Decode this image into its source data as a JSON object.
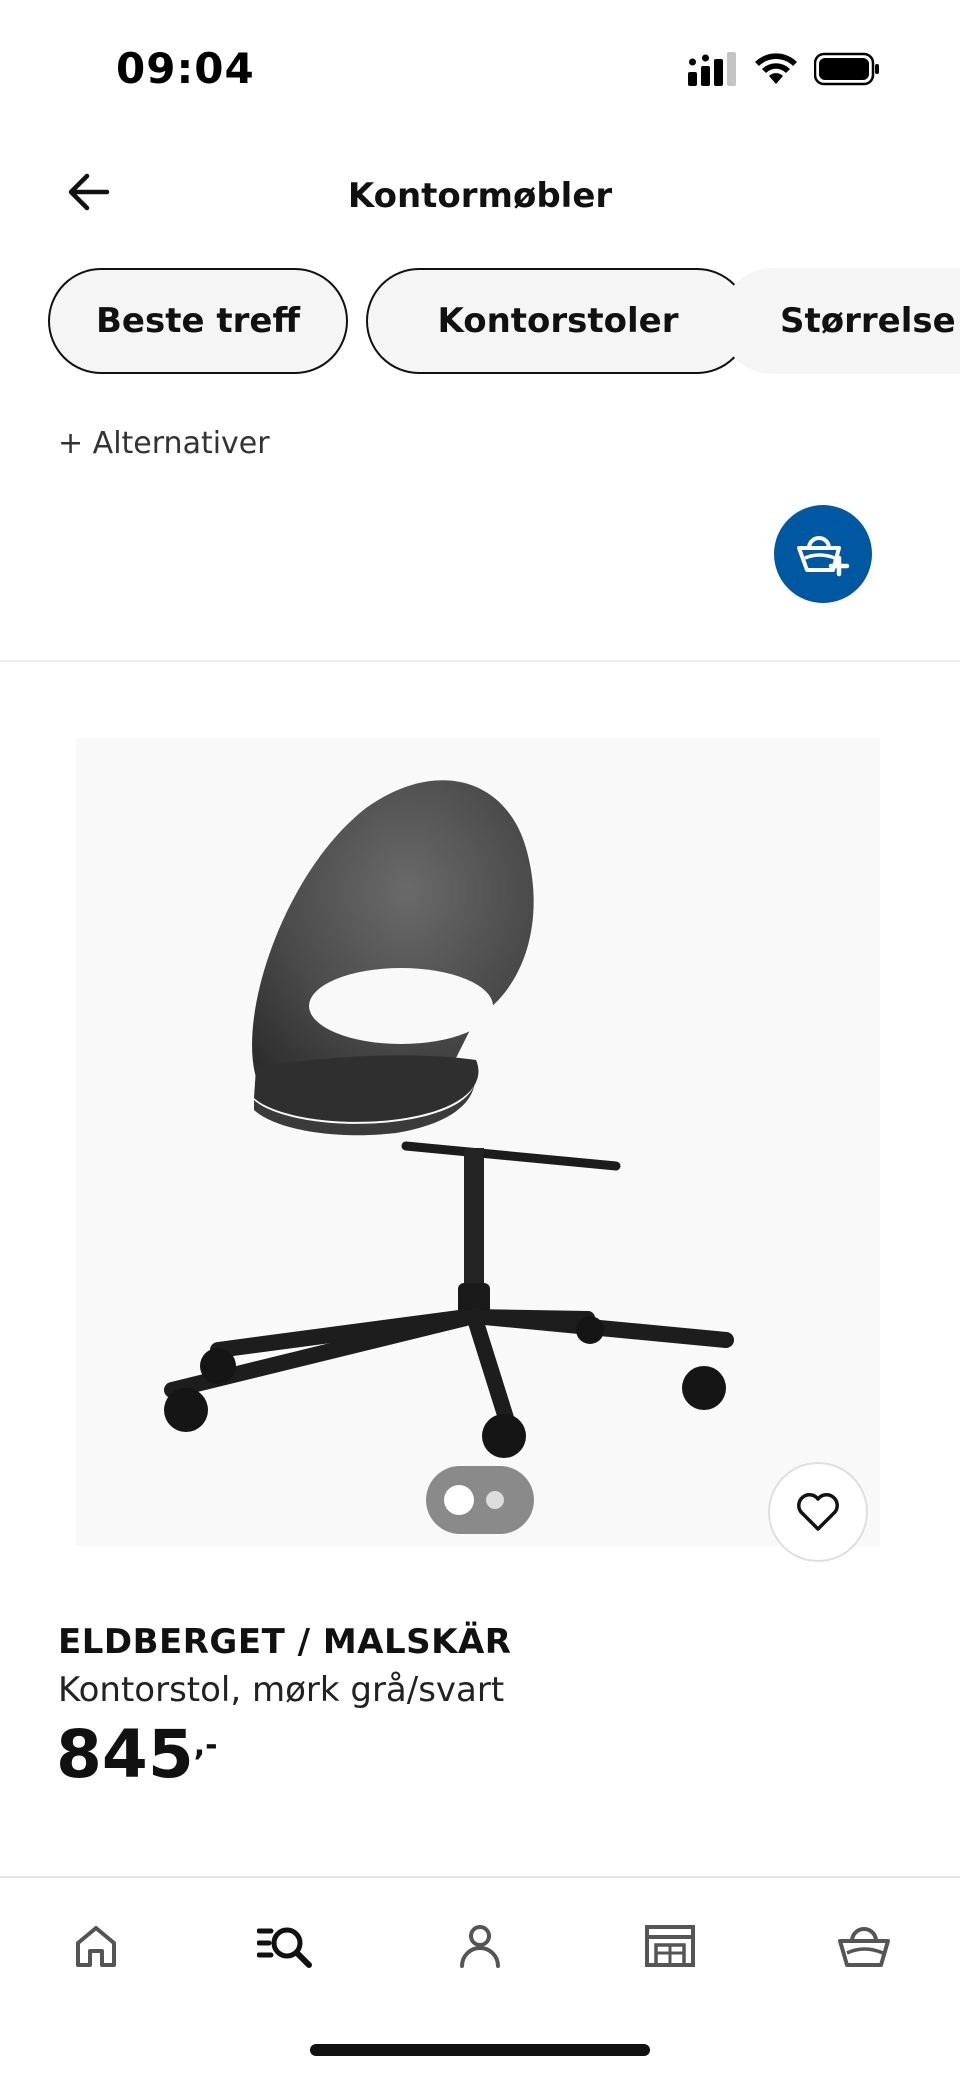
{
  "status_bar": {
    "time": "09:04",
    "icons": [
      "signal-icon",
      "wifi-icon",
      "battery-icon"
    ]
  },
  "header": {
    "title": "Kontormøbler",
    "back_icon": "arrow-left-icon"
  },
  "filters": {
    "chips": [
      {
        "label": "Beste treff"
      },
      {
        "label": "Kontorstoler"
      },
      {
        "label": "Størrelse"
      }
    ],
    "alternatives_label": "+ Alternativer"
  },
  "fab": {
    "icon": "add-to-basket-icon",
    "color": "#0058a3"
  },
  "product": {
    "name": "ELDBERGET / MALSKÄR",
    "description": "Kontorstol, mørk grå/svart",
    "price": "845",
    "price_suffix": ",-",
    "image_icon": "office-chair-image",
    "favorite_icon": "heart-icon"
  },
  "bottom_nav": {
    "items": [
      {
        "icon": "home-icon"
      },
      {
        "icon": "search-list-icon"
      },
      {
        "icon": "profile-icon"
      },
      {
        "icon": "store-icon"
      },
      {
        "icon": "basket-icon"
      }
    ]
  }
}
